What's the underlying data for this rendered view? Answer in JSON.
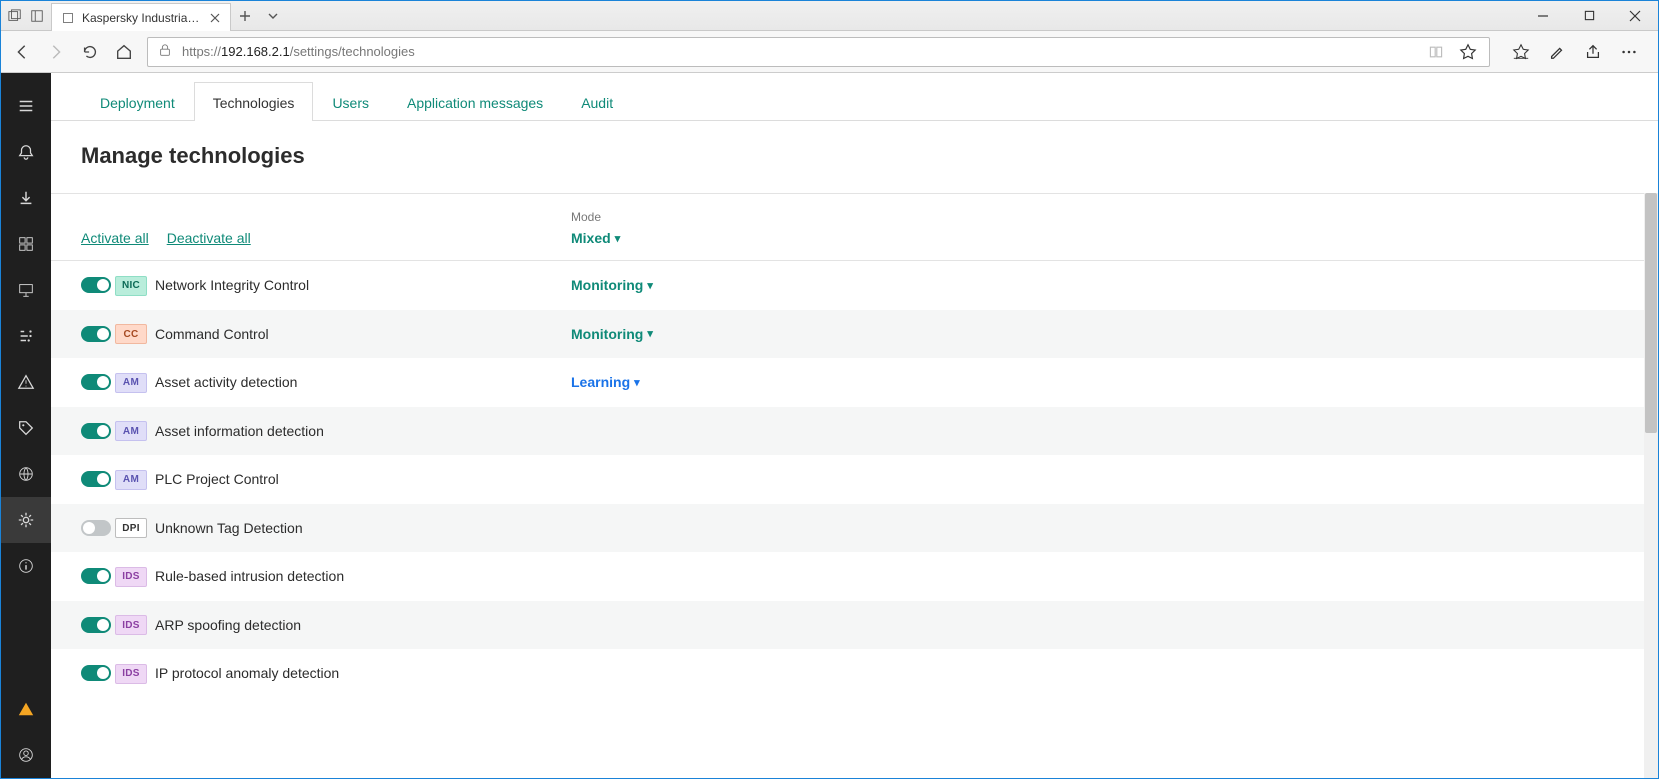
{
  "browser": {
    "tab_title": "Kaspersky Industrial Cyb",
    "url_prefix": "https://",
    "url_host": "192.168.2.1",
    "url_path": "/settings/technologies"
  },
  "tabs": {
    "deployment": "Deployment",
    "technologies": "Technologies",
    "users": "Users",
    "app_messages": "Application messages",
    "audit": "Audit"
  },
  "page": {
    "title": "Manage technologies",
    "activate_all": "Activate all",
    "deactivate_all": "Deactivate all",
    "mode_label": "Mode",
    "mode_value": "Mixed"
  },
  "technologies": [
    {
      "enabled": true,
      "badge_class": "nic",
      "badge": "NIC",
      "name": "Network Integrity Control",
      "mode": "Monitoring",
      "mode_class": ""
    },
    {
      "enabled": true,
      "badge_class": "cc",
      "badge": "CC",
      "name": "Command Control",
      "mode": "Monitoring",
      "mode_class": ""
    },
    {
      "enabled": true,
      "badge_class": "am",
      "badge": "AM",
      "name": "Asset activity detection",
      "mode": "Learning",
      "mode_class": "learning"
    },
    {
      "enabled": true,
      "badge_class": "am",
      "badge": "AM",
      "name": "Asset information detection",
      "mode": "",
      "mode_class": ""
    },
    {
      "enabled": true,
      "badge_class": "am",
      "badge": "AM",
      "name": "PLC Project Control",
      "mode": "",
      "mode_class": ""
    },
    {
      "enabled": false,
      "badge_class": "dpi",
      "badge": "DPI",
      "name": "Unknown Tag Detection",
      "mode": "",
      "mode_class": ""
    },
    {
      "enabled": true,
      "badge_class": "ids",
      "badge": "IDS",
      "name": "Rule-based intrusion detection",
      "mode": "",
      "mode_class": ""
    },
    {
      "enabled": true,
      "badge_class": "ids",
      "badge": "IDS",
      "name": "ARP spoofing detection",
      "mode": "",
      "mode_class": ""
    },
    {
      "enabled": true,
      "badge_class": "ids",
      "badge": "IDS",
      "name": "IP protocol anomaly detection",
      "mode": "",
      "mode_class": ""
    }
  ]
}
